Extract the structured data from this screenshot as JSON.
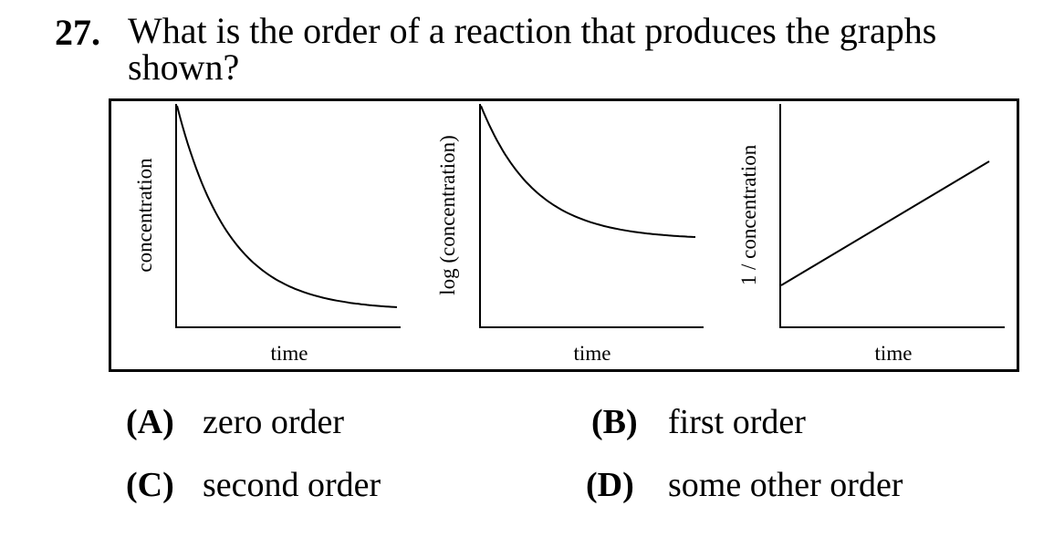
{
  "question": {
    "number": "27.",
    "text": "What is the order of a reaction that produces the graphs shown?"
  },
  "figure": {
    "panels": [
      {
        "ylabel": "concentration",
        "xlabel": "time",
        "curve_shape": "exponential decay"
      },
      {
        "ylabel": "log (concentration)",
        "xlabel": "time",
        "curve_shape": "decreasing concave up"
      },
      {
        "ylabel": "1 / concentration",
        "xlabel": "time",
        "curve_shape": "increasing straight line"
      }
    ]
  },
  "chart_data": [
    {
      "type": "line",
      "xlabel": "time",
      "ylabel": "concentration",
      "grid": false,
      "ticks": false
    },
    {
      "type": "line",
      "xlabel": "time",
      "ylabel": "log (concentration)",
      "grid": false,
      "ticks": false
    },
    {
      "type": "line",
      "xlabel": "time",
      "ylabel": "1 / concentration",
      "grid": false,
      "ticks": false
    }
  ],
  "choices": [
    {
      "letter": "(A)",
      "text": "zero order"
    },
    {
      "letter": "(B)",
      "text": "first order"
    },
    {
      "letter": "(C)",
      "text": "second order"
    },
    {
      "letter": "(D)",
      "text": "some other order"
    }
  ]
}
